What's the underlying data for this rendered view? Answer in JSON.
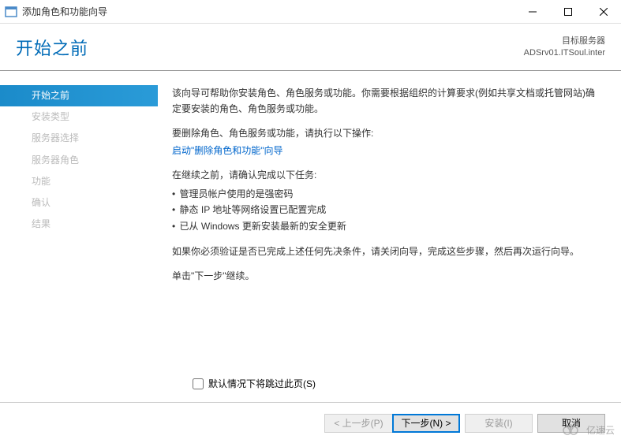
{
  "window": {
    "title": "添加角色和功能向导"
  },
  "header": {
    "page_title": "开始之前",
    "target_label": "目标服务器",
    "target_server": "ADSrv01.ITSoul.inter"
  },
  "sidebar": {
    "items": [
      {
        "label": "开始之前",
        "active": true
      },
      {
        "label": "安装类型",
        "active": false
      },
      {
        "label": "服务器选择",
        "active": false
      },
      {
        "label": "服务器角色",
        "active": false
      },
      {
        "label": "功能",
        "active": false
      },
      {
        "label": "确认",
        "active": false
      },
      {
        "label": "结果",
        "active": false
      }
    ]
  },
  "content": {
    "intro": "该向导可帮助你安装角色、角色服务或功能。你需要根据组织的计算要求(例如共享文档或托管网站)确定要安装的角色、角色服务或功能。",
    "remove_prefix": "要删除角色、角色服务或功能，请执行以下操作:",
    "remove_link": "启动\"删除角色和功能\"向导",
    "verify_prefix": "在继续之前，请确认完成以下任务:",
    "bullets": [
      "管理员帐户使用的是强密码",
      "静态 IP 地址等网络设置已配置完成",
      "已从 Windows 更新安装最新的安全更新"
    ],
    "close_note": "如果你必须验证是否已完成上述任何先决条件，请关闭向导，完成这些步骤，然后再次运行向导。",
    "continue_note": "单击\"下一步\"继续。",
    "skip_checkbox": "默认情况下将跳过此页(S)"
  },
  "footer": {
    "prev": "< 上一步(P)",
    "next": "下一步(N) >",
    "install": "安装(I)",
    "cancel": "取消"
  },
  "watermark": {
    "text": "亿速云"
  }
}
